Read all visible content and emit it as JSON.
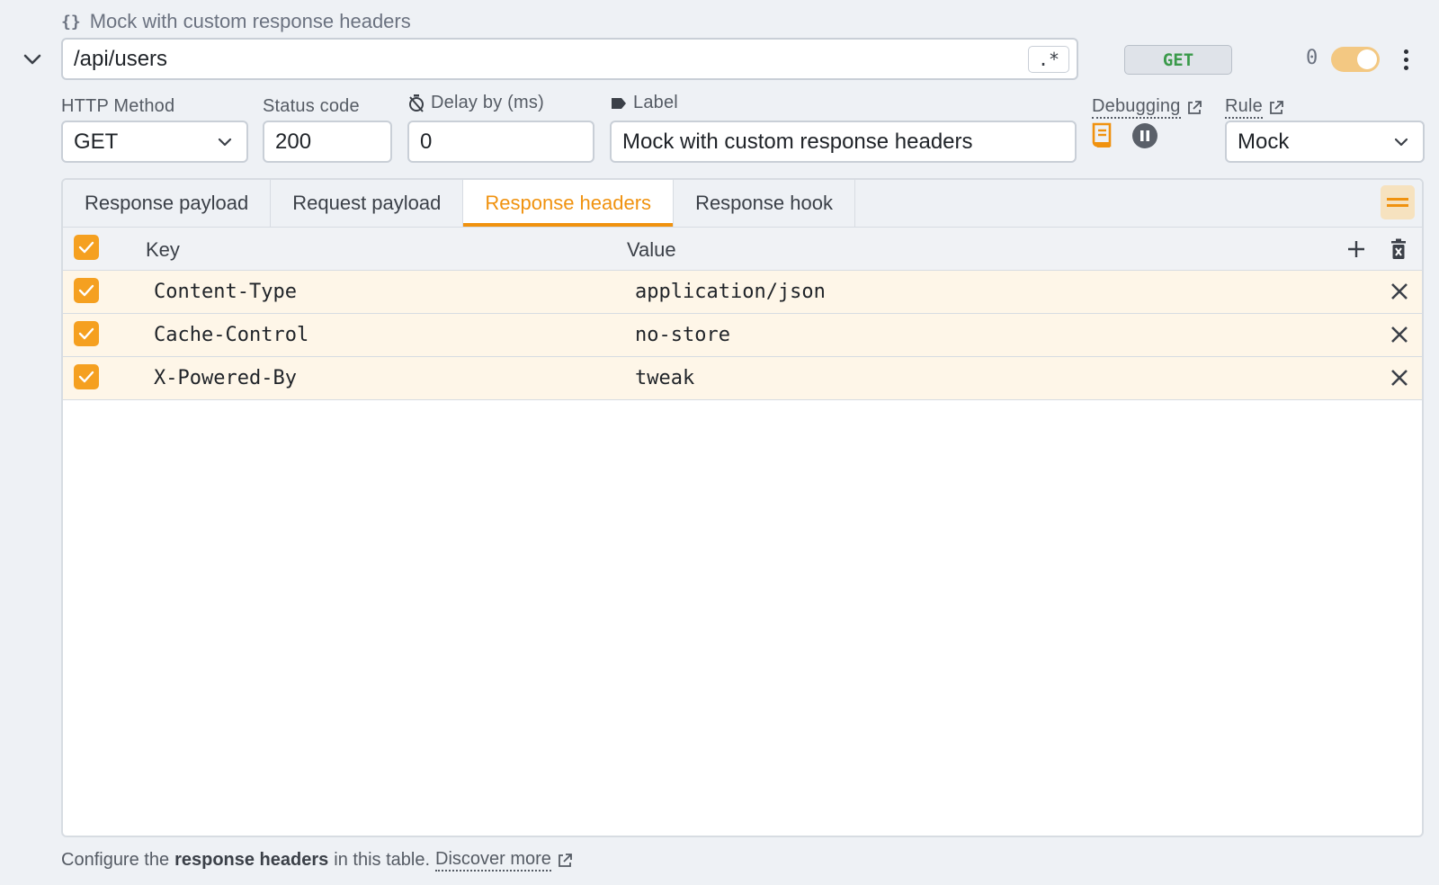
{
  "rule": {
    "title": "Mock with custom response headers",
    "url": "/api/users",
    "regex_label": ".*",
    "method_badge": "GET",
    "hit_count": "0",
    "enabled": true
  },
  "fields": {
    "http_method": {
      "label": "HTTP Method",
      "value": "GET"
    },
    "status_code": {
      "label": "Status code",
      "value": "200"
    },
    "delay": {
      "label": "Delay by (ms)",
      "value": "0"
    },
    "label": {
      "label": "Label",
      "value": "Mock with custom response headers"
    },
    "debugging": {
      "label": "Debugging"
    },
    "rule_type": {
      "label": "Rule",
      "value": "Mock"
    }
  },
  "tabs": [
    {
      "label": "Response payload",
      "active": false
    },
    {
      "label": "Request payload",
      "active": false
    },
    {
      "label": "Response headers",
      "active": true
    },
    {
      "label": "Response hook",
      "active": false
    }
  ],
  "table": {
    "columns": [
      "Key",
      "Value"
    ],
    "rows": [
      {
        "key": "Content-Type",
        "value": "application/json",
        "enabled": true
      },
      {
        "key": "Cache-Control",
        "value": "no-store",
        "enabled": true
      },
      {
        "key": "X-Powered-By",
        "value": "tweak",
        "enabled": true
      }
    ]
  },
  "footer": {
    "prefix": "Configure the",
    "bold": "response headers",
    "suffix": "in this table.",
    "link": "Discover more"
  },
  "colors": {
    "accent": "#f0920f",
    "checkbox": "#f5a020",
    "method_get": "#3a9a4a",
    "row_bg": "#fef6e8"
  },
  "icons": [
    "braces-icon",
    "chevron-down-icon",
    "timer-off-icon",
    "tag-icon",
    "external-link-icon",
    "receipt-icon",
    "pause-icon",
    "equals-icon",
    "plus-icon",
    "delete-all-icon",
    "close-icon",
    "more-vertical-icon"
  ]
}
